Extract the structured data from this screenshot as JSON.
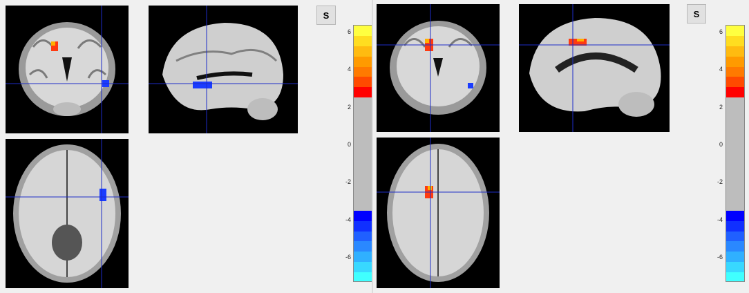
{
  "left_panel": {
    "s_button_label": "S",
    "colorbar_ticks": [
      "6",
      "4",
      "2",
      "0",
      "-2",
      "-4",
      "-6"
    ]
  },
  "right_panel": {
    "s_button_label": "S",
    "colorbar_ticks": [
      "6",
      "4",
      "2",
      "0",
      "-2",
      "-4",
      "-6"
    ]
  },
  "colors": {
    "background": "#f0f0f0",
    "crosshair": "#1e2dc8",
    "positive_cluster": "#ff4010",
    "negative_cluster": "#1a3cff",
    "colorbar": [
      "#ffff40",
      "#ffdd20",
      "#ffbb10",
      "#ff9a00",
      "#ff7a00",
      "#ff4a00",
      "#ff0000",
      "#bdbdbd",
      "#bdbdbd",
      "#bdbdbd",
      "#bdbdbd",
      "#bdbdbd",
      "#bdbdbd",
      "#bdbdbd",
      "#bdbdbd",
      "#bdbdbd",
      "#bdbdbd",
      "#bdbdbd",
      "#0000ff",
      "#1030ff",
      "#2060ff",
      "#2a88ff",
      "#30b0ff",
      "#38d8ff",
      "#40ffff"
    ]
  },
  "icons": {
    "slice_views": [
      "coronal-slice",
      "sagittal-slice",
      "axial-slice"
    ]
  }
}
